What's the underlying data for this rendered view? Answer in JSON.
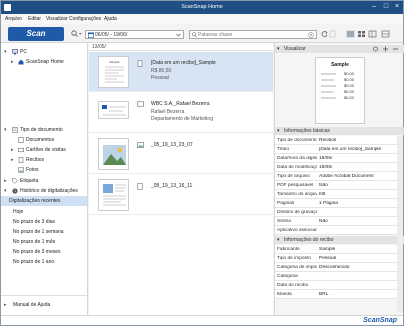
{
  "window": {
    "title": "ScanSnap Home"
  },
  "menu": [
    "Arquivo",
    "Editar",
    "Visualizar",
    "Configurações",
    "Ajuda"
  ],
  "toolbar": {
    "scan_label": "Scan",
    "date_range": "06/05/       - 19/06/",
    "search_placeholder": "Palavras chave"
  },
  "sidebar": {
    "pc_label": "PC",
    "scansnap_home_label": "ScanSnap Home",
    "doc_types_label": "Tipo de documento",
    "doc_types": [
      "Documentos",
      "Cartões de visitas",
      "Recibos",
      "Fotos"
    ],
    "etiqueta_label": "Etiqueta",
    "history_label": "Histórico de digitalizações",
    "history_items": [
      "Digitalizações recentes",
      "Hoje",
      "No prazo de 3 dias",
      "No prazo de 1 semana",
      "No prazo de 1 mês",
      "No prazo de 3 meses",
      "No prazo de 1 ano"
    ],
    "manual_label": "Manual de Ajuda"
  },
  "list": {
    "header_date": "13/05/",
    "rows": [
      {
        "title": "[Data em um recibo]_Sample",
        "sub1": "R$ 80,50",
        "sub2": "Pessoal"
      },
      {
        "title": "WBC S.A._Rafael Bezerra",
        "sub1": "Rafael Bezerra",
        "sub2": "Departamento de Marketing"
      },
      {
        "title": "_05_19_13_23_07",
        "sub1": "",
        "sub2": ""
      },
      {
        "title": "_05_19_13_16_11",
        "sub1": "",
        "sub2": ""
      }
    ]
  },
  "preview": {
    "header": "Visualizar",
    "receipt_title": "Sample",
    "receipt_lines": [
      "$0.00",
      "$0.00",
      "$0.00",
      "$0.00",
      "$0.00"
    ]
  },
  "props": {
    "basic_header": "Informações básicas",
    "basic": [
      {
        "k": "Tipo de documento",
        "v": "Recibos"
      },
      {
        "k": "Título",
        "v": "[Data em um recibo]_Sample"
      },
      {
        "k": "Data/hora da digitalização",
        "v": "19/05/"
      },
      {
        "k": "Data de modificação",
        "v": "19/05/"
      },
      {
        "k": "Tipo de arquivo",
        "v": "Adobe Acrobat Document"
      },
      {
        "k": "PDF pesquisável",
        "v": "Não"
      },
      {
        "k": "Tamanho do arquivo",
        "v": "KB"
      },
      {
        "k": "Páginas",
        "v": "1 Página"
      },
      {
        "k": "Destino de gravação",
        "v": ""
      },
      {
        "k": "Senha",
        "v": "Não"
      },
      {
        "k": "Aplicativo associado",
        "v": ""
      }
    ],
    "receipt_header": "Informações do recibo",
    "receipt": [
      {
        "k": "Fabricante",
        "v": "Sample"
      },
      {
        "k": "Tipo de imposto",
        "v": "Pessoal"
      },
      {
        "k": "Categoria de imposto",
        "v": "Desconhecido"
      },
      {
        "k": "Categoria",
        "v": ""
      },
      {
        "k": "Data do recibo",
        "v": ""
      },
      {
        "k": "Moeda",
        "v": "BRL"
      }
    ]
  },
  "status": {
    "brand": "ScanSnap"
  },
  "colors": {
    "accent": "#1f5aa8",
    "titlebar": "#1f4f84",
    "selection": "#d6e4f3"
  }
}
